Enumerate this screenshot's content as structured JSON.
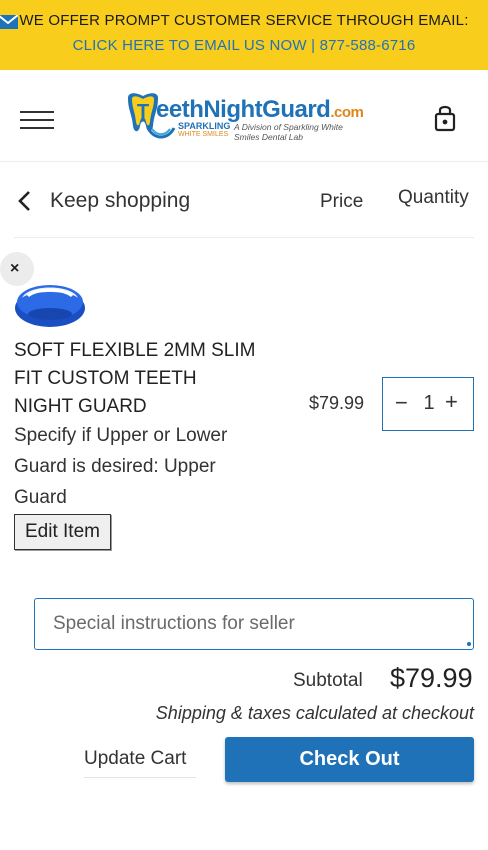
{
  "announcement": {
    "line1": "WE OFFER PROMPT CUSTOMER SERVICE THROUGH EMAIL:",
    "line2": "CLICK HERE TO EMAIL US NOW | 877-588-6716",
    "icon": "mail-icon"
  },
  "header": {
    "menu_icon": "hamburger-menu-icon",
    "logo": {
      "brand_main": "eethNightGuard",
      "brand_tld": ".com",
      "brand_initial": "T",
      "sub1": "SPARKLING",
      "sub2": "WHITE SMILES",
      "division": "A Division of Sparkling White Smiles Dental Lab"
    },
    "cart_icon": "shopping-bag-icon"
  },
  "cart": {
    "keep_shopping": "Keep shopping",
    "col_price": "Price",
    "col_quantity": "Quantity",
    "item": {
      "title_lines": [
        "SOFT FLEXIBLE 2MM SLIM",
        "FIT CUSTOM TEETH",
        "NIGHT GUARD"
      ],
      "option_lines": [
        "Specify if Upper or Lower",
        "Guard is desired: Upper",
        "Guard"
      ],
      "edit_label": "Edit Item",
      "price": "$79.99",
      "quantity": "1",
      "minus": "−",
      "plus": "+",
      "remove": "×"
    },
    "notes_placeholder": "Special instructions for seller",
    "subtotal_label": "Subtotal",
    "subtotal_value": "$79.99",
    "shipping_note": "Shipping & taxes calculated at checkout",
    "update_label": "Update Cart",
    "checkout_label": "Check Out"
  },
  "colors": {
    "announcement_bg": "#f8cd1c",
    "accent_blue": "#1f72b8",
    "logo_orange": "#e0851a"
  }
}
